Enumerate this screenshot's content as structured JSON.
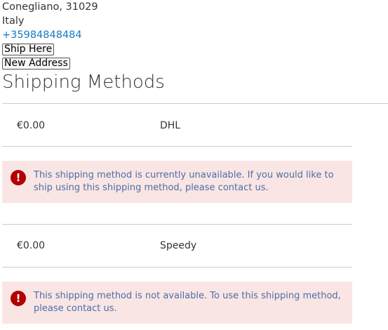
{
  "address": {
    "city_line": "Conegliano, 31029",
    "country": "Italy",
    "phone": "+35984848484"
  },
  "buttons": {
    "ship_here": "Ship Here",
    "new_address": "New Address"
  },
  "shipping": {
    "title": "Shipping Methods",
    "methods": [
      {
        "price": "€0.00",
        "carrier": "DHL",
        "error_icon": "exclamation-icon",
        "error": "This shipping method is currently unavailable. If you would like to ship using this shipping method, please contact us."
      },
      {
        "price": "€0.00",
        "carrier": "Speedy",
        "error_icon": "exclamation-icon",
        "error": "This shipping method is not available. To use this shipping method, please contact us."
      }
    ]
  },
  "colors": {
    "error_bg": "#fae5e5",
    "error_icon": "#b30000",
    "error_text": "#4a6fa5",
    "link": "#1979c3"
  }
}
